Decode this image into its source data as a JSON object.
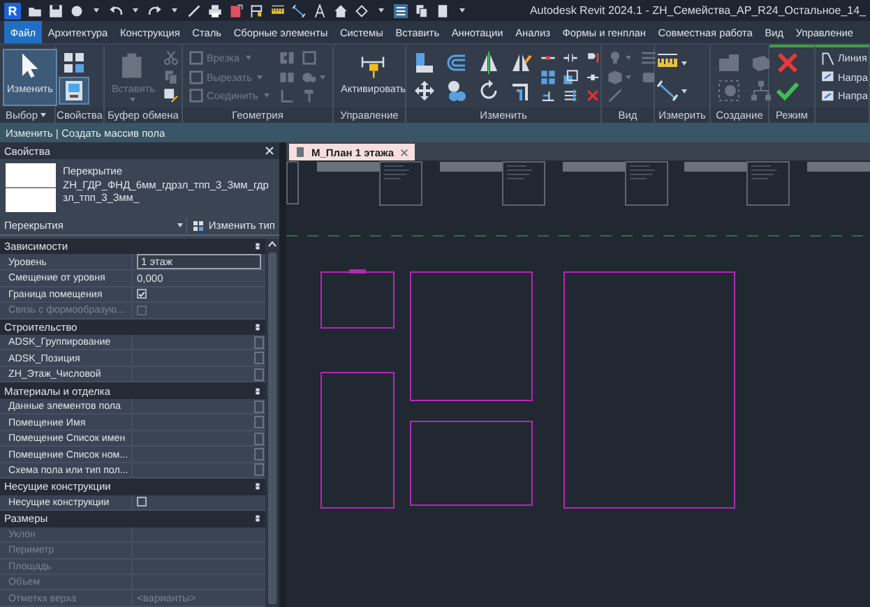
{
  "window": {
    "title": "Autodesk Revit 2024.1 - ZH_Семейства_АР_R24_Остальное_14_"
  },
  "app_button": {
    "label": "R"
  },
  "menu_tabs": [
    {
      "label": "Файл",
      "selected": true
    },
    {
      "label": "Архитектура",
      "selected": false
    },
    {
      "label": "Конструкция",
      "selected": false
    },
    {
      "label": "Сталь",
      "selected": false
    },
    {
      "label": "Сборные элементы",
      "selected": false
    },
    {
      "label": "Системы",
      "selected": false
    },
    {
      "label": "Вставить",
      "selected": false
    },
    {
      "label": "Аннотации",
      "selected": false
    },
    {
      "label": "Анализ",
      "selected": false
    },
    {
      "label": "Формы и генплан",
      "selected": false
    },
    {
      "label": "Совместная работа",
      "selected": false
    },
    {
      "label": "Вид",
      "selected": false
    },
    {
      "label": "Управление",
      "selected": false
    }
  ],
  "ribbon": {
    "panels": [
      {
        "title": "Выбор",
        "menu": true,
        "contextual": false,
        "tools": [
          {
            "kind": "large",
            "label": "Изменить",
            "active": true,
            "disabled": false,
            "menu": false
          }
        ]
      },
      {
        "title": "Свойства",
        "menu": false,
        "contextual": false,
        "tools": [
          {
            "kind": "medium",
            "active": false,
            "disabled": false,
            "menu": false
          },
          {
            "kind": "medium",
            "active": true,
            "disabled": false,
            "menu": false
          }
        ]
      },
      {
        "title": "Буфер обмена",
        "menu": false,
        "contextual": false,
        "tools": [
          {
            "kind": "large",
            "label": "Вставить",
            "active": false,
            "disabled": true,
            "menu": true
          },
          {
            "kind": "icon",
            "active": false,
            "disabled": true,
            "menu": false
          },
          {
            "kind": "icon",
            "active": false,
            "disabled": true,
            "menu": false
          },
          {
            "kind": "icon",
            "active": false,
            "disabled": false,
            "menu": false
          }
        ]
      },
      {
        "title": "Геометрия",
        "menu": false,
        "contextual": false,
        "tools": [
          {
            "kind": "small",
            "label": "Врезка",
            "active": false,
            "disabled": true,
            "menu": true
          },
          {
            "kind": "small",
            "label": "Вырезать",
            "active": false,
            "disabled": true,
            "menu": true
          },
          {
            "kind": "small",
            "label": "Соединить",
            "active": false,
            "disabled": true,
            "menu": true
          },
          {
            "kind": "icon",
            "active": false,
            "disabled": true,
            "menu": false
          },
          {
            "kind": "icon",
            "active": false,
            "disabled": true,
            "menu": false
          },
          {
            "kind": "icon",
            "active": false,
            "disabled": true,
            "menu": false
          },
          {
            "kind": "icon",
            "active": false,
            "disabled": true,
            "menu": false
          },
          {
            "kind": "icon",
            "active": false,
            "disabled": true,
            "menu": true
          },
          {
            "kind": "icon",
            "active": false,
            "disabled": true,
            "menu": false
          }
        ]
      },
      {
        "title": "Управление",
        "menu": false,
        "contextual": false,
        "tools": [
          {
            "kind": "large",
            "label": "Активировать",
            "active": false,
            "disabled": false,
            "menu": false
          }
        ]
      },
      {
        "title": "Изменить",
        "menu": false,
        "contextual": false,
        "tools": [
          {
            "kind": "medium",
            "active": false,
            "disabled": false,
            "menu": false
          },
          {
            "kind": "medium",
            "active": false,
            "disabled": false,
            "menu": false
          },
          {
            "kind": "medium",
            "active": false,
            "disabled": false,
            "menu": false
          },
          {
            "kind": "medium",
            "active": false,
            "disabled": false,
            "menu": false
          },
          {
            "kind": "medium",
            "active": false,
            "disabled": false,
            "menu": false
          },
          {
            "kind": "medium",
            "active": false,
            "disabled": false,
            "menu": false
          },
          {
            "kind": "medium",
            "active": false,
            "disabled": false,
            "menu": false
          },
          {
            "kind": "medium",
            "active": false,
            "disabled": false,
            "menu": false
          },
          {
            "kind": "icon",
            "active": false,
            "disabled": false,
            "menu": false
          },
          {
            "kind": "icon",
            "active": false,
            "disabled": false,
            "menu": false
          },
          {
            "kind": "icon",
            "active": false,
            "disabled": false,
            "menu": false
          },
          {
            "kind": "icon",
            "active": false,
            "disabled": false,
            "menu": false
          },
          {
            "kind": "icon",
            "active": false,
            "disabled": false,
            "menu": false
          },
          {
            "kind": "icon",
            "active": false,
            "disabled": false,
            "menu": false
          },
          {
            "kind": "icon",
            "active": false,
            "disabled": false,
            "menu": false
          },
          {
            "kind": "icon",
            "active": false,
            "disabled": false,
            "menu": false
          },
          {
            "kind": "icon",
            "active": false,
            "disabled": false,
            "menu": false
          }
        ]
      },
      {
        "title": "Вид",
        "menu": false,
        "contextual": false,
        "tools": [
          {
            "kind": "icon",
            "active": false,
            "disabled": true,
            "menu": true
          },
          {
            "kind": "icon",
            "active": false,
            "disabled": true,
            "menu": true
          },
          {
            "kind": "icon",
            "active": false,
            "disabled": true,
            "menu": false
          },
          {
            "kind": "icon",
            "active": false,
            "disabled": true,
            "menu": false
          },
          {
            "kind": "icon",
            "active": false,
            "disabled": true,
            "menu": false
          }
        ]
      },
      {
        "title": "Измерить",
        "menu": false,
        "contextual": false,
        "tools": [
          {
            "kind": "medium",
            "active": false,
            "disabled": false,
            "menu": true
          },
          {
            "kind": "medium",
            "active": false,
            "disabled": false,
            "menu": true
          }
        ]
      },
      {
        "title": "Создание",
        "menu": false,
        "contextual": false,
        "tools": [
          {
            "kind": "medium",
            "active": false,
            "disabled": true,
            "menu": false
          },
          {
            "kind": "medium",
            "active": false,
            "disabled": true,
            "menu": false
          },
          {
            "kind": "medium",
            "active": false,
            "disabled": true,
            "menu": false
          },
          {
            "kind": "medium",
            "active": false,
            "disabled": true,
            "menu": false
          }
        ]
      },
      {
        "title": "Режим",
        "menu": false,
        "contextual": true,
        "tools": [
          {
            "kind": "medium",
            "active": false,
            "disabled": false,
            "menu": false
          },
          {
            "kind": "medium",
            "active": false,
            "disabled": false,
            "menu": false
          }
        ]
      },
      {
        "contextual": true,
        "tools": [
          {
            "kind": "small",
            "label": "Линия",
            "active": false,
            "disabled": false
          },
          {
            "kind": "small",
            "label": "Напра",
            "active": false,
            "disabled": false
          },
          {
            "kind": "small",
            "label": "Напра",
            "active": false,
            "disabled": false
          }
        ]
      }
    ]
  },
  "context_bar": {
    "text": "Изменить | Создать массив пола"
  },
  "properties": {
    "title": "Свойства",
    "type_family": "Перекрытие",
    "type_name": "ZH_ГДР_ФНД_6мм_гдрзл_тпп_3_3мм_гдрзл_тпп_3_3мм_",
    "category": "Перекрытия",
    "edit_type": "Изменить тип",
    "groups": [
      {
        "title": "Зависимости",
        "rows": [
          {
            "kind": "field",
            "name": "Уровень",
            "value": "1 этаж",
            "disabled": false
          },
          {
            "kind": "text",
            "name": "Смещение от уровня",
            "value": "0,000",
            "disabled": false
          },
          {
            "kind": "checkbox",
            "name": "Граница помещения",
            "checked": true,
            "disabled": false
          },
          {
            "kind": "checkbox",
            "name": "Связь с формообразую...",
            "checked": false,
            "disabled": true
          }
        ]
      },
      {
        "title": "Строительство",
        "rows": [
          {
            "kind": "edit",
            "name": "ADSK_Группирование",
            "disabled": false
          },
          {
            "kind": "edit",
            "name": "ADSK_Позиция",
            "disabled": false
          },
          {
            "kind": "edit",
            "name": "ZH_Этаж_Числовой",
            "disabled": false
          }
        ]
      },
      {
        "title": "Материалы и отделка",
        "rows": [
          {
            "kind": "edit",
            "name": "Данные элементов пола",
            "disabled": false
          },
          {
            "kind": "edit",
            "name": "Помещение Имя",
            "disabled": false
          },
          {
            "kind": "edit",
            "name": "Помещение Список имен",
            "disabled": false
          },
          {
            "kind": "edit",
            "name": "Помещение Список ном...",
            "disabled": false
          },
          {
            "kind": "edit",
            "name": "Схема пола или тип пол...",
            "disabled": false
          }
        ]
      },
      {
        "title": "Несущие конструкции",
        "rows": [
          {
            "kind": "checkbox",
            "name": "Несущие конструкции",
            "checked": false,
            "disabled": false
          }
        ]
      },
      {
        "title": "Размеры",
        "rows": [
          {
            "kind": "empty",
            "name": "Уклон",
            "disabled": true
          },
          {
            "kind": "empty",
            "name": "Периметр",
            "disabled": true
          },
          {
            "kind": "empty",
            "name": "Площадь",
            "disabled": true
          },
          {
            "kind": "empty",
            "name": "Объем",
            "disabled": true
          },
          {
            "kind": "text",
            "name": "Отметка верха",
            "value": "<варианты>",
            "disabled": true
          }
        ]
      }
    ]
  },
  "view": {
    "tabs": [
      {
        "label": "М_План 1 этажа",
        "selected": true
      }
    ]
  }
}
